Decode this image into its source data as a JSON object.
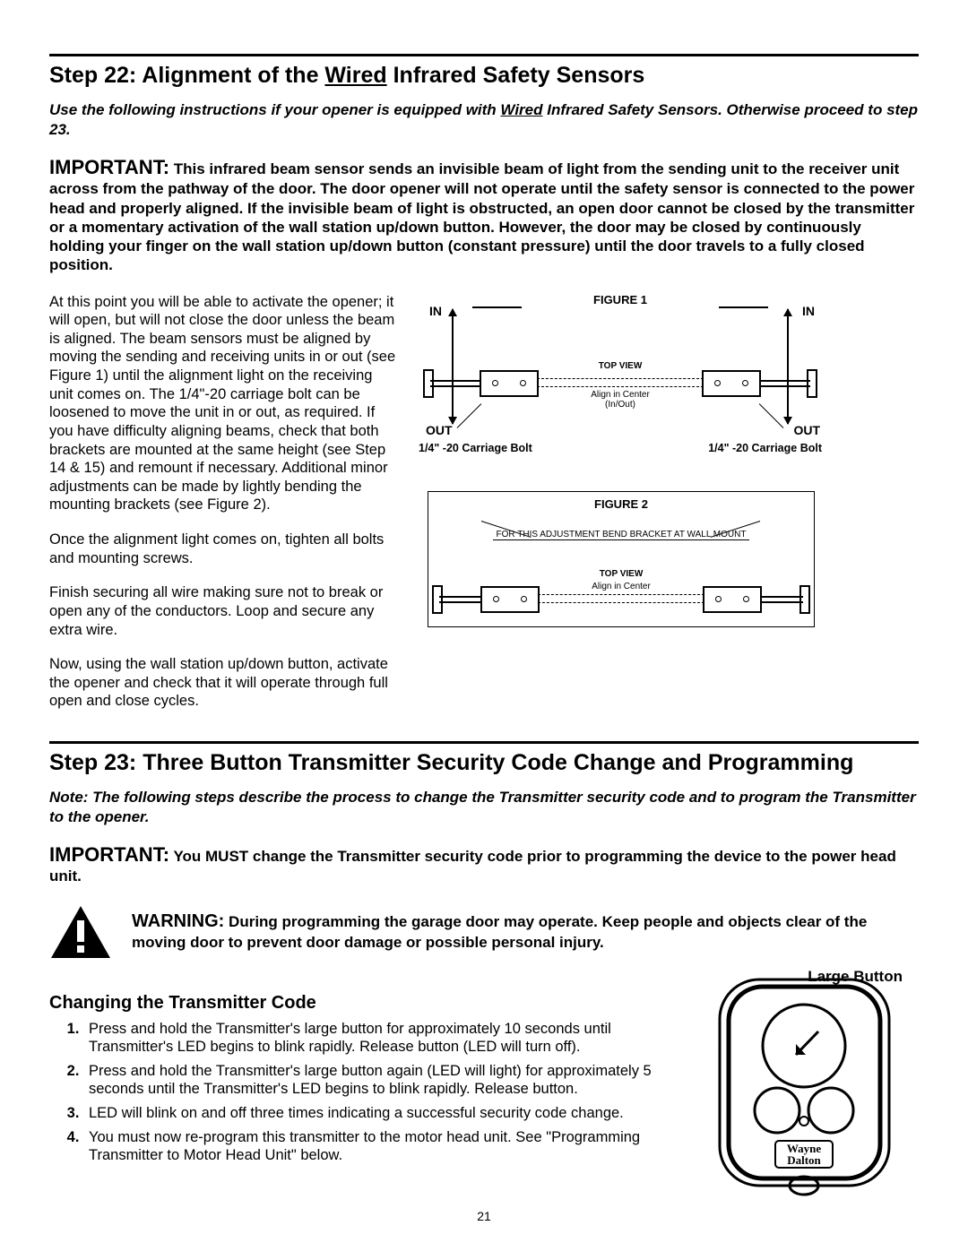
{
  "step22": {
    "heading_pre": "Step 22: Alignment of the ",
    "heading_underlined": "Wired",
    "heading_post": " Infrared Safety Sensors",
    "note_pre": "Use the following instructions if your opener is equipped with ",
    "note_under": "Wired",
    "note_post": " Infrared Safety Sensors. Otherwise proceed to step 23.",
    "important_lead": "IMPORTANT:",
    "important_body": " This infrared beam sensor sends an invisible beam of light from the sending unit to the receiver unit across from the pathway of the door. The door opener will not operate until the safety sensor is connected to the power head and properly aligned. If the invisible beam of light is obstructed, an open door cannot be closed by the transmitter or a momentary activation of the wall station up/down button. However, the door may be closed by continuously holding your finger on the wall station up/down button (constant pressure) until the door travels to a fully closed position.",
    "p1": "At this point you will be able to activate the opener; it will open, but will not close the door unless the beam is aligned.  The beam sensors must be aligned by moving the sending and receiving units in or out (see Figure 1) until the alignment light on the receiving unit comes on. The 1/4\"-20 carriage bolt can be loosened to move the unit in or out, as required. If you have difficulty aligning beams, check that both brackets are mounted at the same height (see Step 14 & 15) and remount if necessary. Additional minor adjustments can be made by lightly bending the mounting brackets (see Figure 2).",
    "p2": "Once the alignment light comes on, tighten all bolts and mounting screws.",
    "p3": "Finish securing all wire making sure not to break or open any of the conductors. Loop and secure any extra wire.",
    "p4": "Now, using the wall station up/down button, activate the opener and check that it will operate through full open and close cycles.",
    "fig1": {
      "title": "FIGURE 1",
      "in": "IN",
      "out": "OUT",
      "top_view": "TOP VIEW",
      "align_center": "Align in Center",
      "in_out": "(In/Out)",
      "bolt": "1/4\" -20 Carriage Bolt"
    },
    "fig2": {
      "title": "FIGURE 2",
      "bend": "FOR THIS ADJUSTMENT BEND BRACKET AT WALL MOUNT",
      "top_view": "TOP VIEW",
      "align_center": "Align in Center"
    }
  },
  "step23": {
    "heading": "Step 23: Three Button Transmitter Security Code Change and Programming",
    "note": "Note: The following steps describe the process to change the Transmitter security code and to program the Transmitter to the opener.",
    "important_lead": "IMPORTANT:",
    "important_body": " You MUST change the Transmitter security code prior to programming the device to the power head unit.",
    "warning_lead": "WARNING:",
    "warning_body": " During programming the garage door may operate. Keep people and objects clear of the moving door to prevent door damage or possible personal injury.",
    "large_button": "Large Button",
    "subheading": "Changing the Transmitter Code",
    "steps": [
      "Press and hold the Transmitter's large button for approximately 10 seconds until Transmitter's LED begins to blink rapidly. Release button (LED will turn off).",
      "Press and hold the Transmitter's large button again (LED will light) for approximately 5 seconds until the Transmitter's LED begins to blink rapidly.  Release button.",
      "LED will blink on and off three times indicating a successful security code change.",
      "You must now re-program this transmitter to the motor head unit. See \"Programming Transmitter to Motor Head Unit\" below."
    ],
    "brand1": "Wayne",
    "brand2": "Dalton"
  },
  "page_number": "21"
}
